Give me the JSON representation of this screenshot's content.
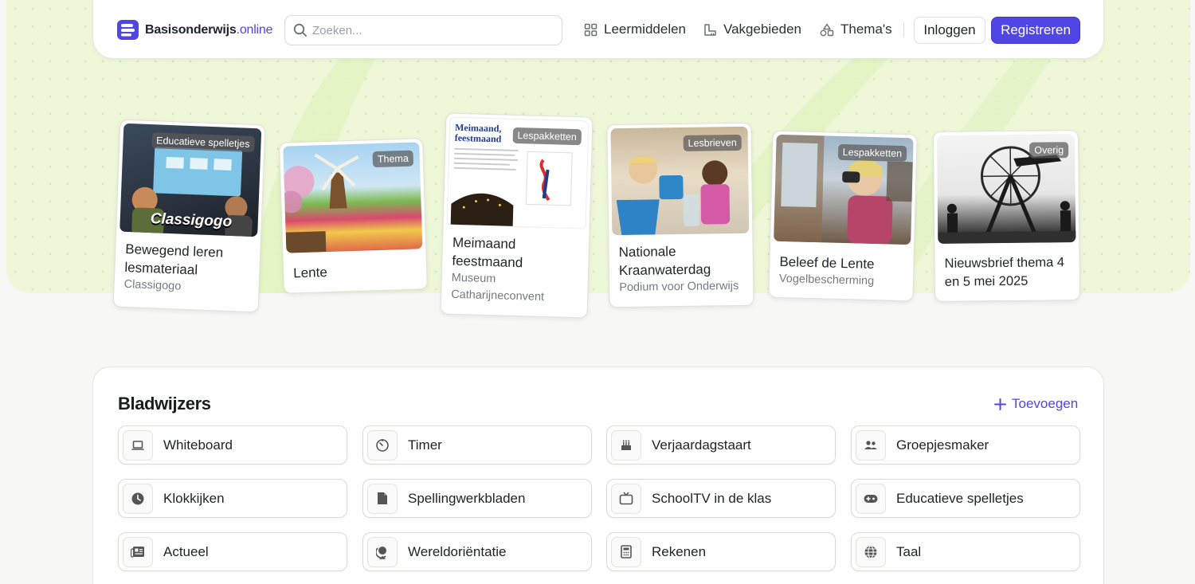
{
  "header": {
    "logo_primary": "Basisonderwijs",
    "logo_accent": ".online",
    "search_placeholder": "Zoeken...",
    "nav": [
      {
        "label": "Leermiddelen",
        "icon": "grid-icon"
      },
      {
        "label": "Vakgebieden",
        "icon": "ruler-icon"
      },
      {
        "label": "Thema's",
        "icon": "shapes-icon"
      }
    ],
    "login_label": "Inloggen",
    "register_label": "Registreren"
  },
  "featured": [
    {
      "badge": "Educatieve spelletjes",
      "title": "Bewegend leren lesmateriaal",
      "subtitle": "Classigogo",
      "thumb_text": "Classigogo"
    },
    {
      "badge": "Thema",
      "title": "Lente",
      "subtitle": ""
    },
    {
      "badge": "Lespakketten",
      "title": "Meimaand feestmaand",
      "subtitle": "Museum Catharijneconvent",
      "thumb_text": "Meimaand, feestmaand"
    },
    {
      "badge": "Lesbrieven",
      "title": "Nationale Kraanwaterdag",
      "subtitle": "Podium voor Onderwijs"
    },
    {
      "badge": "Lespakketten",
      "title": "Beleef de Lente",
      "subtitle": "Vogelbescherming"
    },
    {
      "badge": "Overig",
      "title": "Nieuwsbrief thema 4 en 5 mei 2025",
      "subtitle": ""
    }
  ],
  "bookmarks": {
    "title": "Bladwijzers",
    "add_label": "Toevoegen",
    "items": [
      {
        "label": "Whiteboard",
        "icon": "laptop-icon"
      },
      {
        "label": "Timer",
        "icon": "timer-icon"
      },
      {
        "label": "Verjaardagstaart",
        "icon": "cake-icon"
      },
      {
        "label": "Groepjesmaker",
        "icon": "group-icon"
      },
      {
        "label": "Klokkijken",
        "icon": "clock-icon"
      },
      {
        "label": "Spellingwerkbladen",
        "icon": "document-icon"
      },
      {
        "label": "SchoolTV in de klas",
        "icon": "tv-icon"
      },
      {
        "label": "Educatieve spelletjes",
        "icon": "gamepad-icon"
      },
      {
        "label": "Actueel",
        "icon": "newspaper-icon"
      },
      {
        "label": "Wereldoriëntatie",
        "icon": "globe-stand-icon"
      },
      {
        "label": "Rekenen",
        "icon": "calculator-icon"
      },
      {
        "label": "Taal",
        "icon": "language-globe-icon"
      }
    ]
  },
  "colors": {
    "accent": "#4f46e5",
    "hero_bg": "#eef8d9"
  }
}
